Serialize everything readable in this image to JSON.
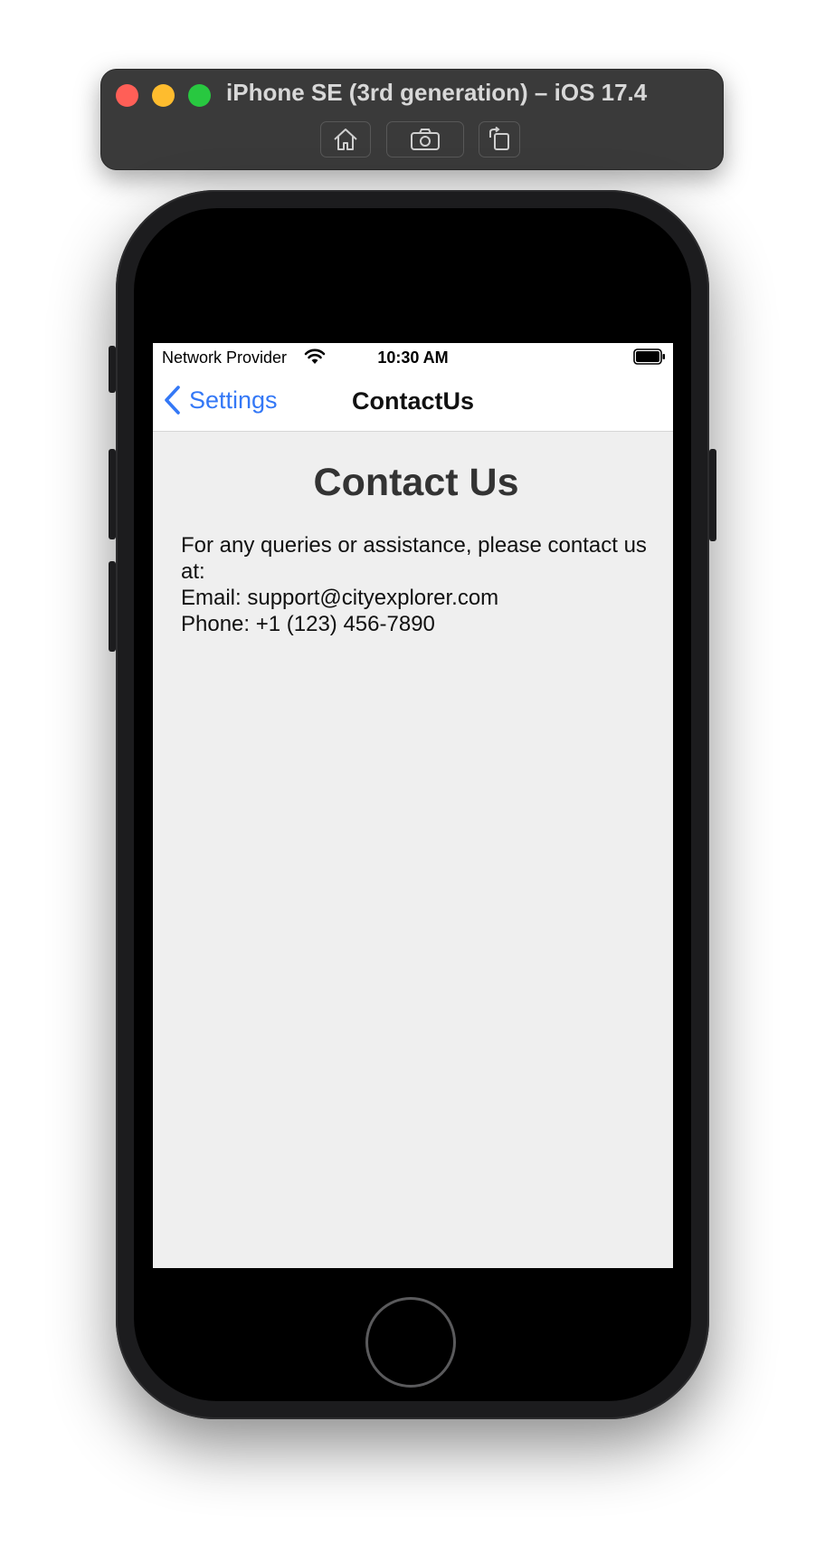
{
  "simulator": {
    "title": "iPhone SE (3rd generation) – iOS 17.4",
    "toolbar": {
      "home_icon": "home-icon",
      "screenshot_icon": "camera-icon",
      "rotate_icon": "rotate-icon"
    }
  },
  "status_bar": {
    "carrier": "Network Provider",
    "time": "10:30 AM",
    "wifi_icon": "wifi-icon",
    "battery_icon": "battery-icon"
  },
  "nav_bar": {
    "back_label": "Settings",
    "title": "ContactUs"
  },
  "content": {
    "heading": "Contact Us",
    "intro": "For any queries or assistance, please contact us at:",
    "email": "Email: support@cityexplorer.com",
    "phone": "Phone: +1 (123) 456-7890"
  },
  "colors": {
    "accent": "#3478f6",
    "screen_background": "#efefef",
    "heading": "#333333"
  }
}
